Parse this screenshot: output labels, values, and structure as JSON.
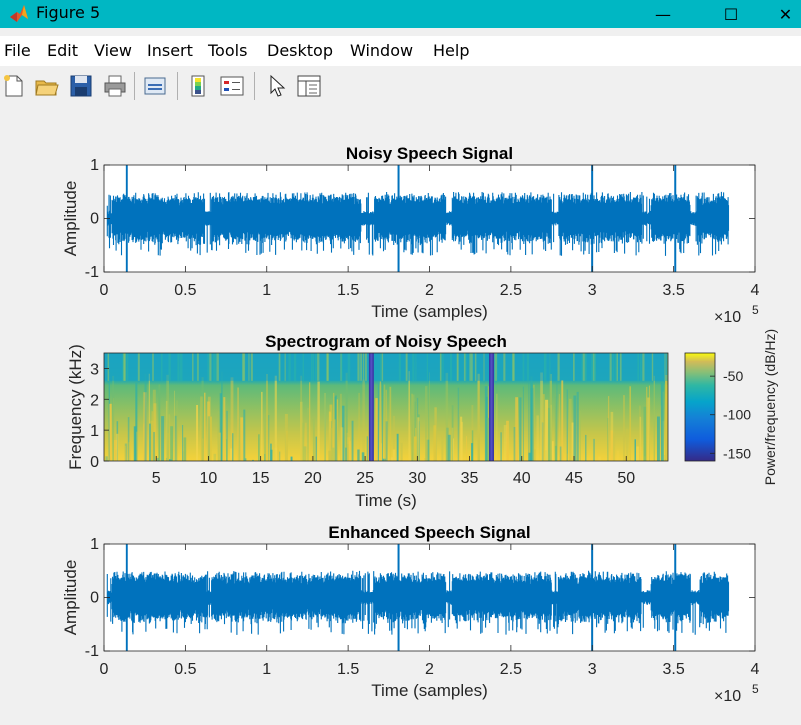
{
  "window": {
    "title": "Figure 5",
    "controls": [
      "—",
      "☐",
      "✕"
    ]
  },
  "menu": [
    "File",
    "Edit",
    "View",
    "Insert",
    "Tools",
    "Desktop",
    "Window",
    "Help"
  ],
  "toolbar": {
    "icons": [
      "new-figure-icon",
      "open-file-icon",
      "save-icon",
      "print-icon",
      "link-plot-icon",
      "colorbar-icon",
      "legend-icon",
      "pointer-icon",
      "property-inspector-icon"
    ]
  },
  "colors": {
    "titlebar": "#00b7c3",
    "signal": "#0072bd"
  },
  "chart_data": [
    {
      "type": "line",
      "title": "Noisy Speech Signal",
      "xlabel": "Time (samples)",
      "ylabel": "Amplitude",
      "xlim": [
        0,
        4
      ],
      "ylim": [
        -1,
        1
      ],
      "x_exponent_label": "×10",
      "x_exponent": "5",
      "xticks": [
        "0",
        "0.5",
        "1",
        "1.5",
        "2",
        "2.5",
        "3",
        "3.5",
        "4"
      ],
      "yticks": [
        "-1",
        "0",
        "1"
      ],
      "series": [
        {
          "values_summary": "speech waveform, ~384000 samples, typical amplitude ±0.5 with spikes to ±1 near 0.14, 1.81, 3.0 and 3.5 (×10^5 samples)"
        }
      ]
    },
    {
      "type": "heatmap",
      "title": "Spectrogram of Noisy Speech",
      "xlabel": "Time (s)",
      "ylabel": "Frequency (kHz)",
      "xlim": [
        0,
        54
      ],
      "ylim": [
        0,
        3.5
      ],
      "xticks": [
        "5",
        "10",
        "15",
        "20",
        "25",
        "30",
        "35",
        "40",
        "45",
        "50"
      ],
      "yticks": [
        "0",
        "1",
        "2",
        "3"
      ],
      "colorbar": {
        "label": "Power/frequency (dB/Hz)",
        "range": [
          -160,
          -20
        ],
        "ticks": [
          "-50",
          "-100",
          "-150"
        ]
      }
    },
    {
      "type": "line",
      "title": "Enhanced Speech Signal",
      "xlabel": "Time (samples)",
      "ylabel": "Amplitude",
      "xlim": [
        0,
        4
      ],
      "ylim": [
        -1,
        1
      ],
      "x_exponent_label": "×10",
      "x_exponent": "5",
      "xticks": [
        "0",
        "0.5",
        "1",
        "1.5",
        "2",
        "2.5",
        "3",
        "3.5",
        "4"
      ],
      "yticks": [
        "-1",
        "0",
        "1"
      ],
      "series": [
        {
          "values_summary": "enhanced speech waveform, ~384000 samples, amplitude ±0.5 with spikes to ±1 near 0.14, 1.81, 3.0 and 3.5 (×10^5 samples)"
        }
      ]
    }
  ]
}
